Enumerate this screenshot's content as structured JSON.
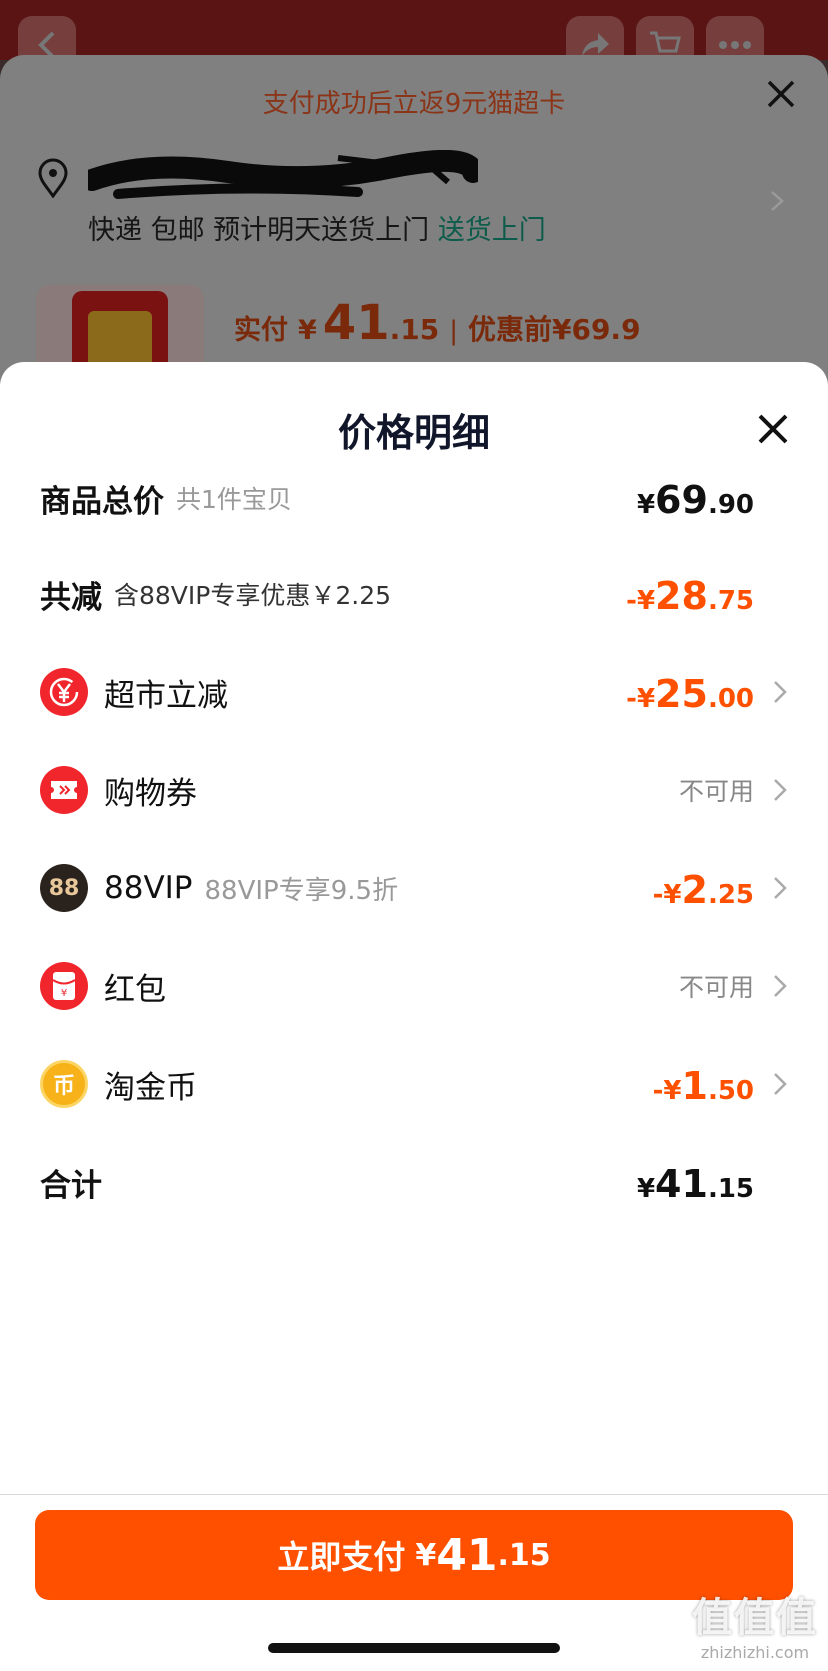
{
  "background_page": {
    "promo_text": "支付成功后立返9元猫超卡",
    "delivery": {
      "text": "快递 包邮 预计明天送货上门",
      "highlight": "送货上门"
    },
    "price": {
      "label": "实付",
      "currency": "¥",
      "integer": "41",
      "decimal": ".15",
      "separator": "|",
      "before_label": "优惠前",
      "before_value": "¥69.9"
    },
    "icons": [
      "back-icon",
      "share-icon",
      "cart-icon",
      "more-icon",
      "close-icon",
      "location-icon"
    ]
  },
  "sheet": {
    "title": "价格明细",
    "close_icon": "close-icon",
    "rows": {
      "total": {
        "label": "商品总价",
        "sub": "共1件宝贝",
        "currency": "¥",
        "integer": "69",
        "decimal": ".90"
      },
      "reduction": {
        "label": "共减",
        "sub": "含88VIP专享优惠￥2.25",
        "currency": "-¥",
        "integer": "28",
        "decimal": ".75"
      },
      "supermarket": {
        "label": "超市立减",
        "icon": "yen-refresh-icon",
        "currency": "-¥",
        "integer": "25",
        "decimal": ".00"
      },
      "coupon": {
        "label": "购物券",
        "icon": "ticket-icon",
        "status": "不可用"
      },
      "vip": {
        "label": "88VIP",
        "icon_text": "88",
        "sub": "88VIP专享9.5折",
        "currency": "-¥",
        "integer": "2",
        "decimal": ".25"
      },
      "redpacket": {
        "label": "红包",
        "icon": "red-packet-icon",
        "status": "不可用"
      },
      "taocoin": {
        "label": "淘金币",
        "icon_text": "币",
        "currency": "-¥",
        "integer": "1",
        "decimal": ".50"
      },
      "sum": {
        "label": "合计",
        "currency": "¥",
        "integer": "41",
        "decimal": ".15"
      }
    }
  },
  "footer": {
    "pay_label": "立即支付",
    "currency": "¥",
    "integer": "41",
    "decimal": ".15"
  },
  "watermark": {
    "glyphs": "值值值",
    "url": "zhizhizhi.com"
  },
  "colors": {
    "accent": "#ff5000",
    "overlay_bg": "#808080",
    "promo": "#8a3418"
  }
}
